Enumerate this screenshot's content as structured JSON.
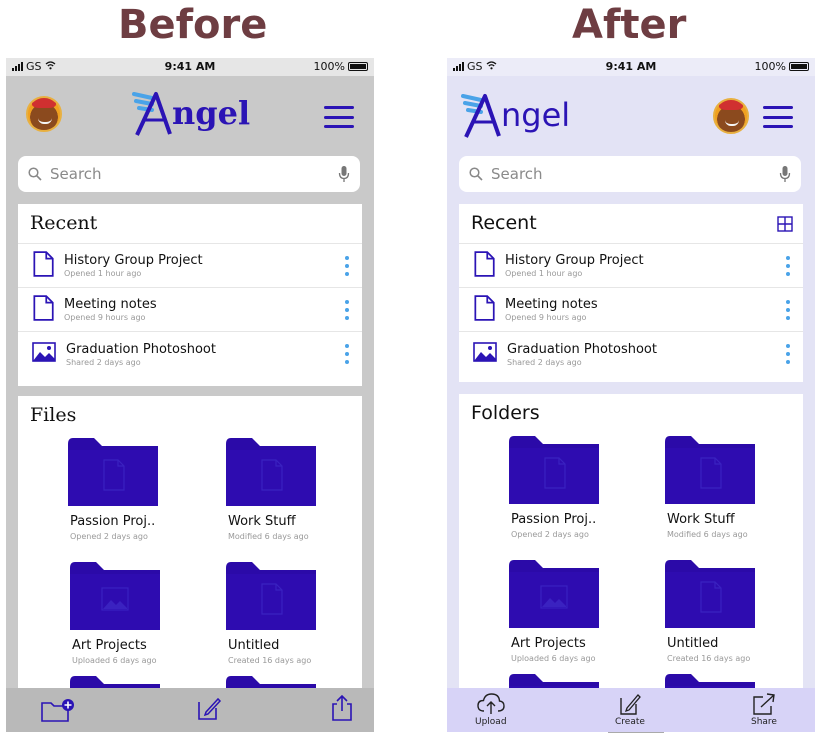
{
  "headings": {
    "before": "Before",
    "after": "After"
  },
  "status": {
    "carrier": "GS",
    "time": "9:41 AM",
    "battery": "100%"
  },
  "brand": {
    "name": "ngel",
    "accent": "#2b14b5",
    "wing": "#4aa3e8"
  },
  "search": {
    "placeholder": "Search"
  },
  "before": {
    "recent_title": "Recent",
    "files_title": "Files",
    "recent": [
      {
        "name": "History Group Project",
        "meta": "Opened 1 hour ago",
        "icon": "document-icon"
      },
      {
        "name": "Meeting notes",
        "meta": "Opened 9 hours ago",
        "icon": "document-icon"
      },
      {
        "name": "Graduation Photoshoot",
        "meta": "Shared 2 days ago",
        "icon": "image-icon"
      }
    ],
    "folders": [
      {
        "name": "Passion Proj..",
        "meta": "Opened 2 days ago",
        "icon": "document-icon"
      },
      {
        "name": "Work Stuff",
        "meta": "Modified 6 days ago",
        "icon": "document-icon"
      },
      {
        "name": "Art Projects",
        "meta": "Uploaded 6 days ago",
        "icon": "image-icon"
      },
      {
        "name": "Untitled",
        "meta": "Created 16 days ago",
        "icon": "document-icon"
      }
    ]
  },
  "after": {
    "recent_title": "Recent",
    "files_title": "Folders",
    "recent": [
      {
        "name": "History Group Project",
        "meta": "Opened 1 hour ago",
        "icon": "document-icon"
      },
      {
        "name": "Meeting notes",
        "meta": "Opened 9 hours ago",
        "icon": "document-icon"
      },
      {
        "name": "Graduation Photoshoot",
        "meta": "Shared 2 days ago",
        "icon": "image-icon"
      }
    ],
    "folders": [
      {
        "name": "Passion Proj..",
        "meta": "Opened 2 days ago",
        "icon": "document-icon"
      },
      {
        "name": "Work Stuff",
        "meta": "Modified 6 days ago",
        "icon": "document-icon"
      },
      {
        "name": "Art Projects",
        "meta": "Uploaded 6 days ago",
        "icon": "image-icon"
      },
      {
        "name": "Untitled",
        "meta": "Created 16 days ago",
        "icon": "document-icon"
      }
    ],
    "tabs": {
      "upload": "Upload",
      "create": "Create",
      "share": "Share"
    }
  }
}
